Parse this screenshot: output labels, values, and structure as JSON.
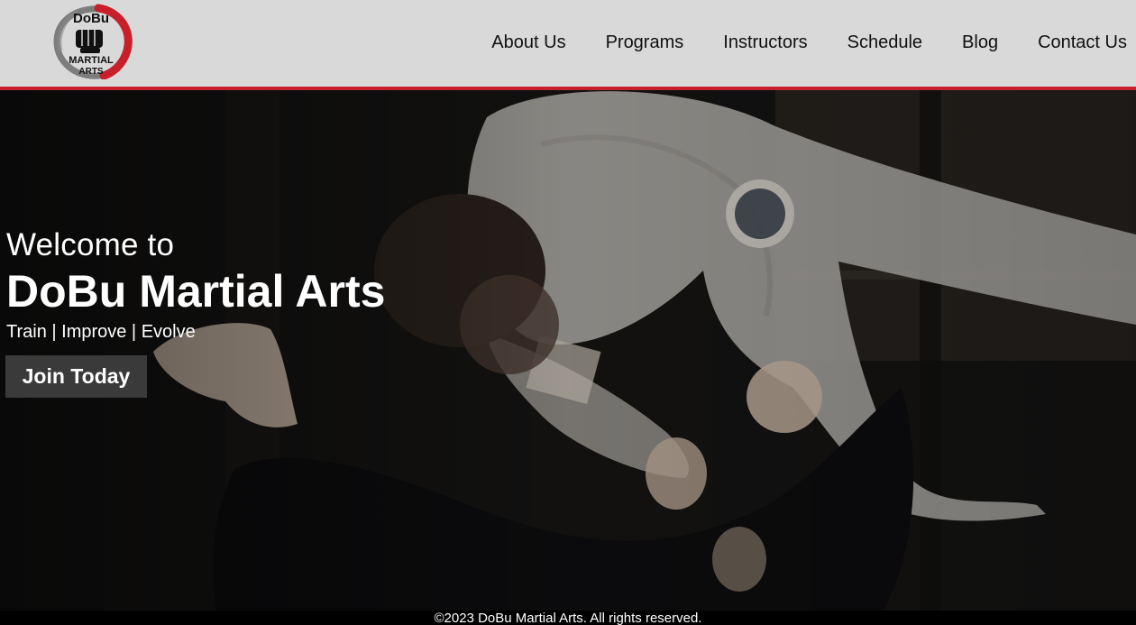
{
  "header": {
    "logo": {
      "lines": [
        "DoBu",
        "MARTIAL",
        "ARTS"
      ],
      "colors": {
        "ring": "#c8202b",
        "ink": "#111111"
      }
    },
    "nav": [
      {
        "label": "About Us"
      },
      {
        "label": "Programs"
      },
      {
        "label": "Instructors"
      },
      {
        "label": "Schedule"
      },
      {
        "label": "Blog"
      },
      {
        "label": "Contact Us"
      }
    ],
    "accent_color": "#c8202b",
    "background_color": "#d9d9d9"
  },
  "hero": {
    "welcome": "Welcome to",
    "brand": "DoBu Martial Arts",
    "tagline": "Train | Improve | Evolve",
    "cta_label": "Join Today",
    "image_subject": "two martial artists in gi mid-throw"
  },
  "footer": {
    "copyright": "©2023 DoBu Martial Arts. All rights reserved."
  }
}
